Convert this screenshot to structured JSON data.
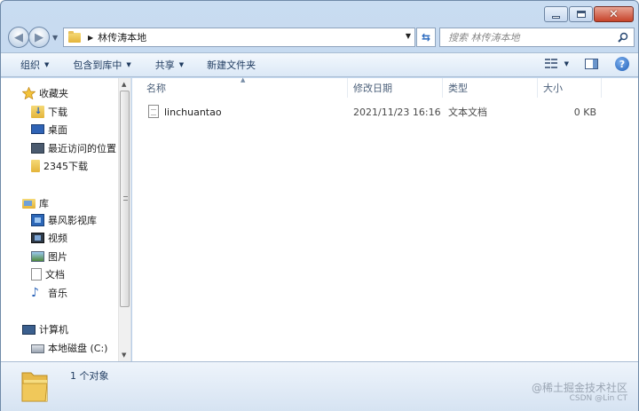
{
  "window": {
    "controls": {
      "minimize": "minimize-icon",
      "maximize": "maximize-icon",
      "close": "close-icon"
    }
  },
  "address": {
    "path": [
      "林传涛本地"
    ],
    "search_placeholder": "搜索 林传涛本地"
  },
  "toolbar": {
    "organize": "组织",
    "include_in_library": "包含到库中",
    "share": "共享",
    "new_folder": "新建文件夹"
  },
  "sidebar": {
    "favorites": {
      "label": "收藏夹",
      "items": [
        {
          "label": "下载",
          "icon": "downloads-icon"
        },
        {
          "label": "桌面",
          "icon": "desktop-icon"
        },
        {
          "label": "最近访问的位置",
          "icon": "recent-places-icon"
        },
        {
          "label": "2345下载",
          "icon": "folder-icon"
        }
      ]
    },
    "libraries": {
      "label": "库",
      "items": [
        {
          "label": "暴风影视库",
          "icon": "video-library-icon"
        },
        {
          "label": "视频",
          "icon": "video-icon"
        },
        {
          "label": "图片",
          "icon": "picture-icon"
        },
        {
          "label": "文档",
          "icon": "document-icon"
        },
        {
          "label": "音乐",
          "icon": "music-icon"
        }
      ]
    },
    "computer": {
      "label": "计算机",
      "items": [
        {
          "label": "本地磁盘 (C:)",
          "icon": "drive-icon"
        }
      ]
    }
  },
  "columns": {
    "name": "名称",
    "modified": "修改日期",
    "type": "类型",
    "size": "大小"
  },
  "files": [
    {
      "name": "linchuantao",
      "modified": "2021/11/23 16:16",
      "type": "文本文档",
      "size": "0 KB"
    }
  ],
  "status": {
    "count": "1 个对象"
  },
  "watermark": {
    "line1": "@稀土掘金技术社区",
    "line2": "CSDN @Lin CT"
  },
  "colors": {
    "accent": "#2c6bbf",
    "toolbar_text": "#1e3a5f",
    "column_header": "#4c607a"
  }
}
